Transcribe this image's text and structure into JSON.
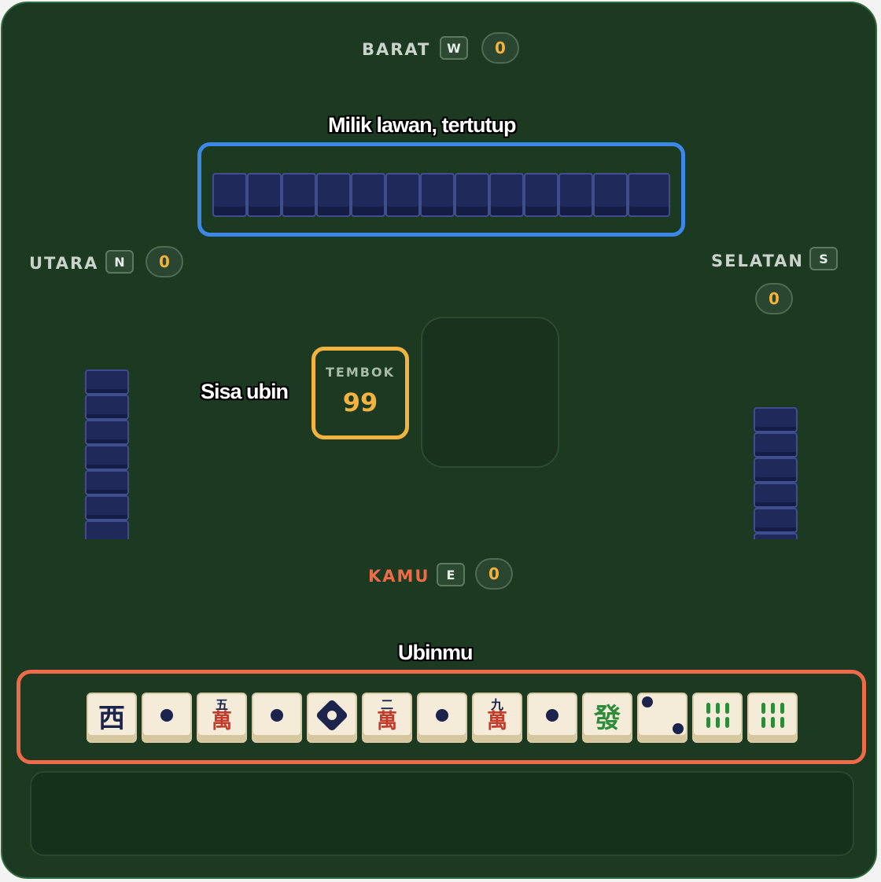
{
  "players": {
    "top": {
      "name": "BARAT",
      "wind": "W",
      "score": "0"
    },
    "left": {
      "name": "UTARA",
      "wind": "N",
      "score": "0"
    },
    "right": {
      "name": "SELATAN",
      "wind": "S",
      "score": "0"
    },
    "bottom": {
      "name": "KAMU",
      "wind": "E",
      "score": "0"
    }
  },
  "wall": {
    "label": "TEMBOK",
    "count": "99"
  },
  "annotations": {
    "opponent_hand": "Milik lawan, tertutup",
    "remaining": "Sisa ubin",
    "my_hand": "Ubinmu"
  },
  "opponents": {
    "top_tile_count": 13,
    "left_visible_tiles": 7,
    "right_visible_tiles": 6
  },
  "hand": [
    {
      "kind": "honor",
      "glyph": "西",
      "color": "navy"
    },
    {
      "kind": "dots",
      "value": 1
    },
    {
      "kind": "man",
      "numeral": "五",
      "wan": "萬"
    },
    {
      "kind": "dots",
      "value": 1
    },
    {
      "kind": "dots-special",
      "value": 1
    },
    {
      "kind": "man",
      "numeral": "二",
      "wan": "萬"
    },
    {
      "kind": "dots",
      "value": 1
    },
    {
      "kind": "man",
      "numeral": "九",
      "wan": "萬"
    },
    {
      "kind": "dots",
      "value": 1
    },
    {
      "kind": "honor",
      "glyph": "發",
      "color": "green"
    },
    {
      "kind": "dots",
      "value": 2
    },
    {
      "kind": "bamboo",
      "value": 6
    },
    {
      "kind": "bamboo",
      "value": 6
    }
  ],
  "colors": {
    "felt": "#1b3a21",
    "tile_back": "#1f2a5a",
    "tile_face": "#f4ecd8",
    "accent_blue": "#3b87ea",
    "accent_orange": "#ee6a48",
    "accent_yellow": "#f4b23e"
  }
}
